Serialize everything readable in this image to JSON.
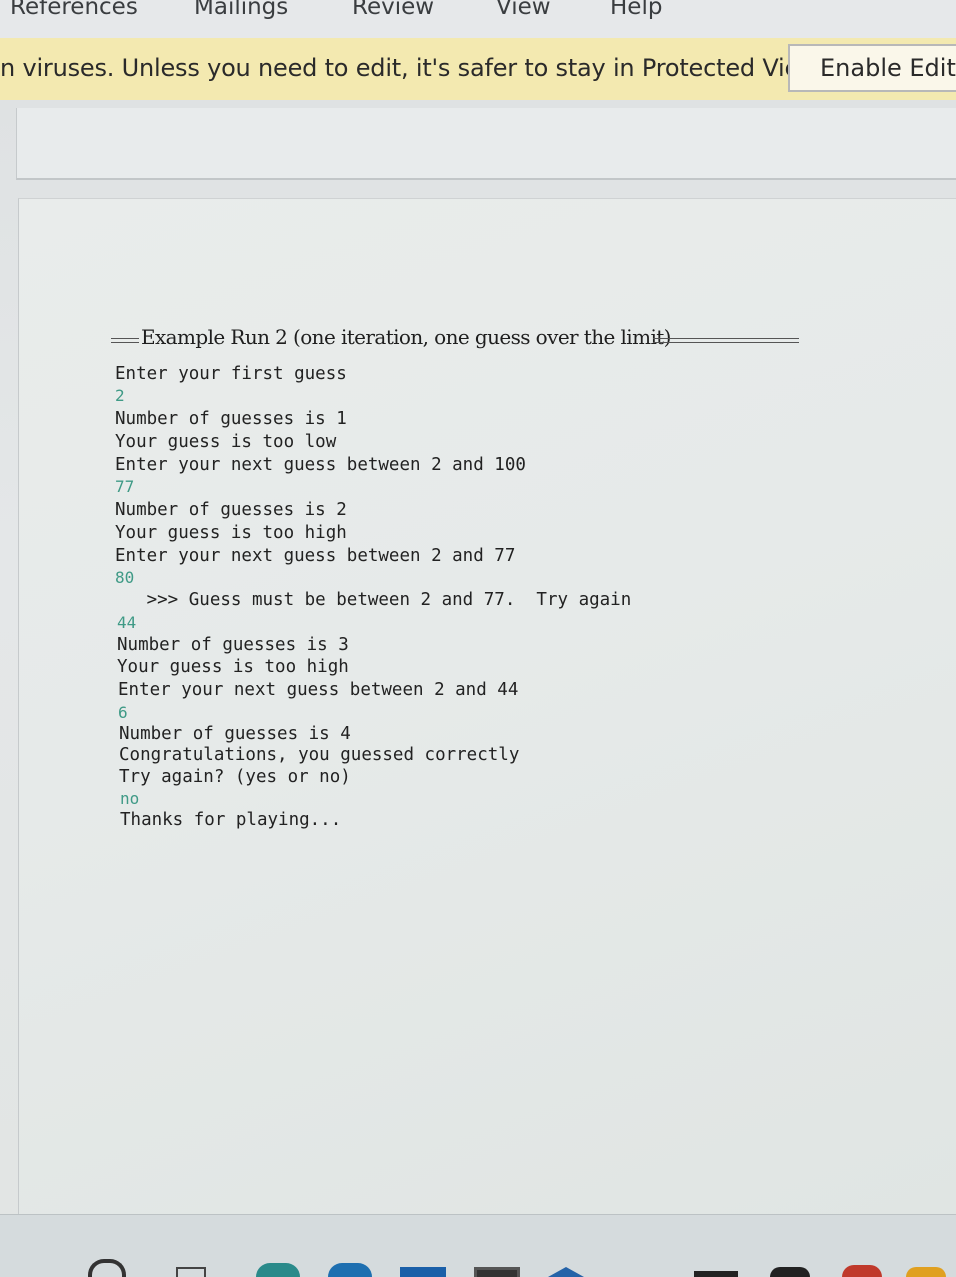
{
  "ribbon": {
    "tabs": [
      "References",
      "Mailings",
      "Review",
      "View",
      "Help"
    ]
  },
  "protected_view": {
    "message": "n viruses. Unless you need to edit, it's safer to stay in Protected View.",
    "enable_button": "Enable Editir"
  },
  "document": {
    "heading": "Example Run 2 (one iteration, one guess over the limit)",
    "console_lines": [
      {
        "text": "Enter your first guess",
        "kind": "output"
      },
      {
        "text": "2",
        "kind": "input"
      },
      {
        "text": "Number of guesses is 1",
        "kind": "output"
      },
      {
        "text": "Your guess is too low",
        "kind": "output"
      },
      {
        "text": "Enter your next guess between 2 and 100",
        "kind": "output"
      },
      {
        "text": "77",
        "kind": "input"
      },
      {
        "text": "Number of guesses is 2",
        "kind": "output"
      },
      {
        "text": "Your guess is too high",
        "kind": "output"
      },
      {
        "text": "Enter your next guess between 2 and 77",
        "kind": "output"
      },
      {
        "text": "80",
        "kind": "input"
      },
      {
        "text": "   >>> Guess must be between 2 and 77.  Try again",
        "kind": "output"
      },
      {
        "text": "44",
        "kind": "input"
      },
      {
        "text": "Number of guesses is 3",
        "kind": "output"
      },
      {
        "text": "Your guess is too high",
        "kind": "output"
      },
      {
        "text": "Enter your next guess between 2 and 44",
        "kind": "output"
      },
      {
        "text": "6",
        "kind": "input"
      },
      {
        "text": "Number of guesses is 4",
        "kind": "output"
      },
      {
        "text": "Congratulations, you guessed correctly",
        "kind": "output"
      },
      {
        "text": "Try again? (yes or no)",
        "kind": "output"
      },
      {
        "text": "no",
        "kind": "input"
      },
      {
        "text": "Thanks for playing...",
        "kind": "output"
      }
    ]
  },
  "colors": {
    "input_text": "#3f9a86",
    "protected_bar": "#f3e9b0"
  }
}
